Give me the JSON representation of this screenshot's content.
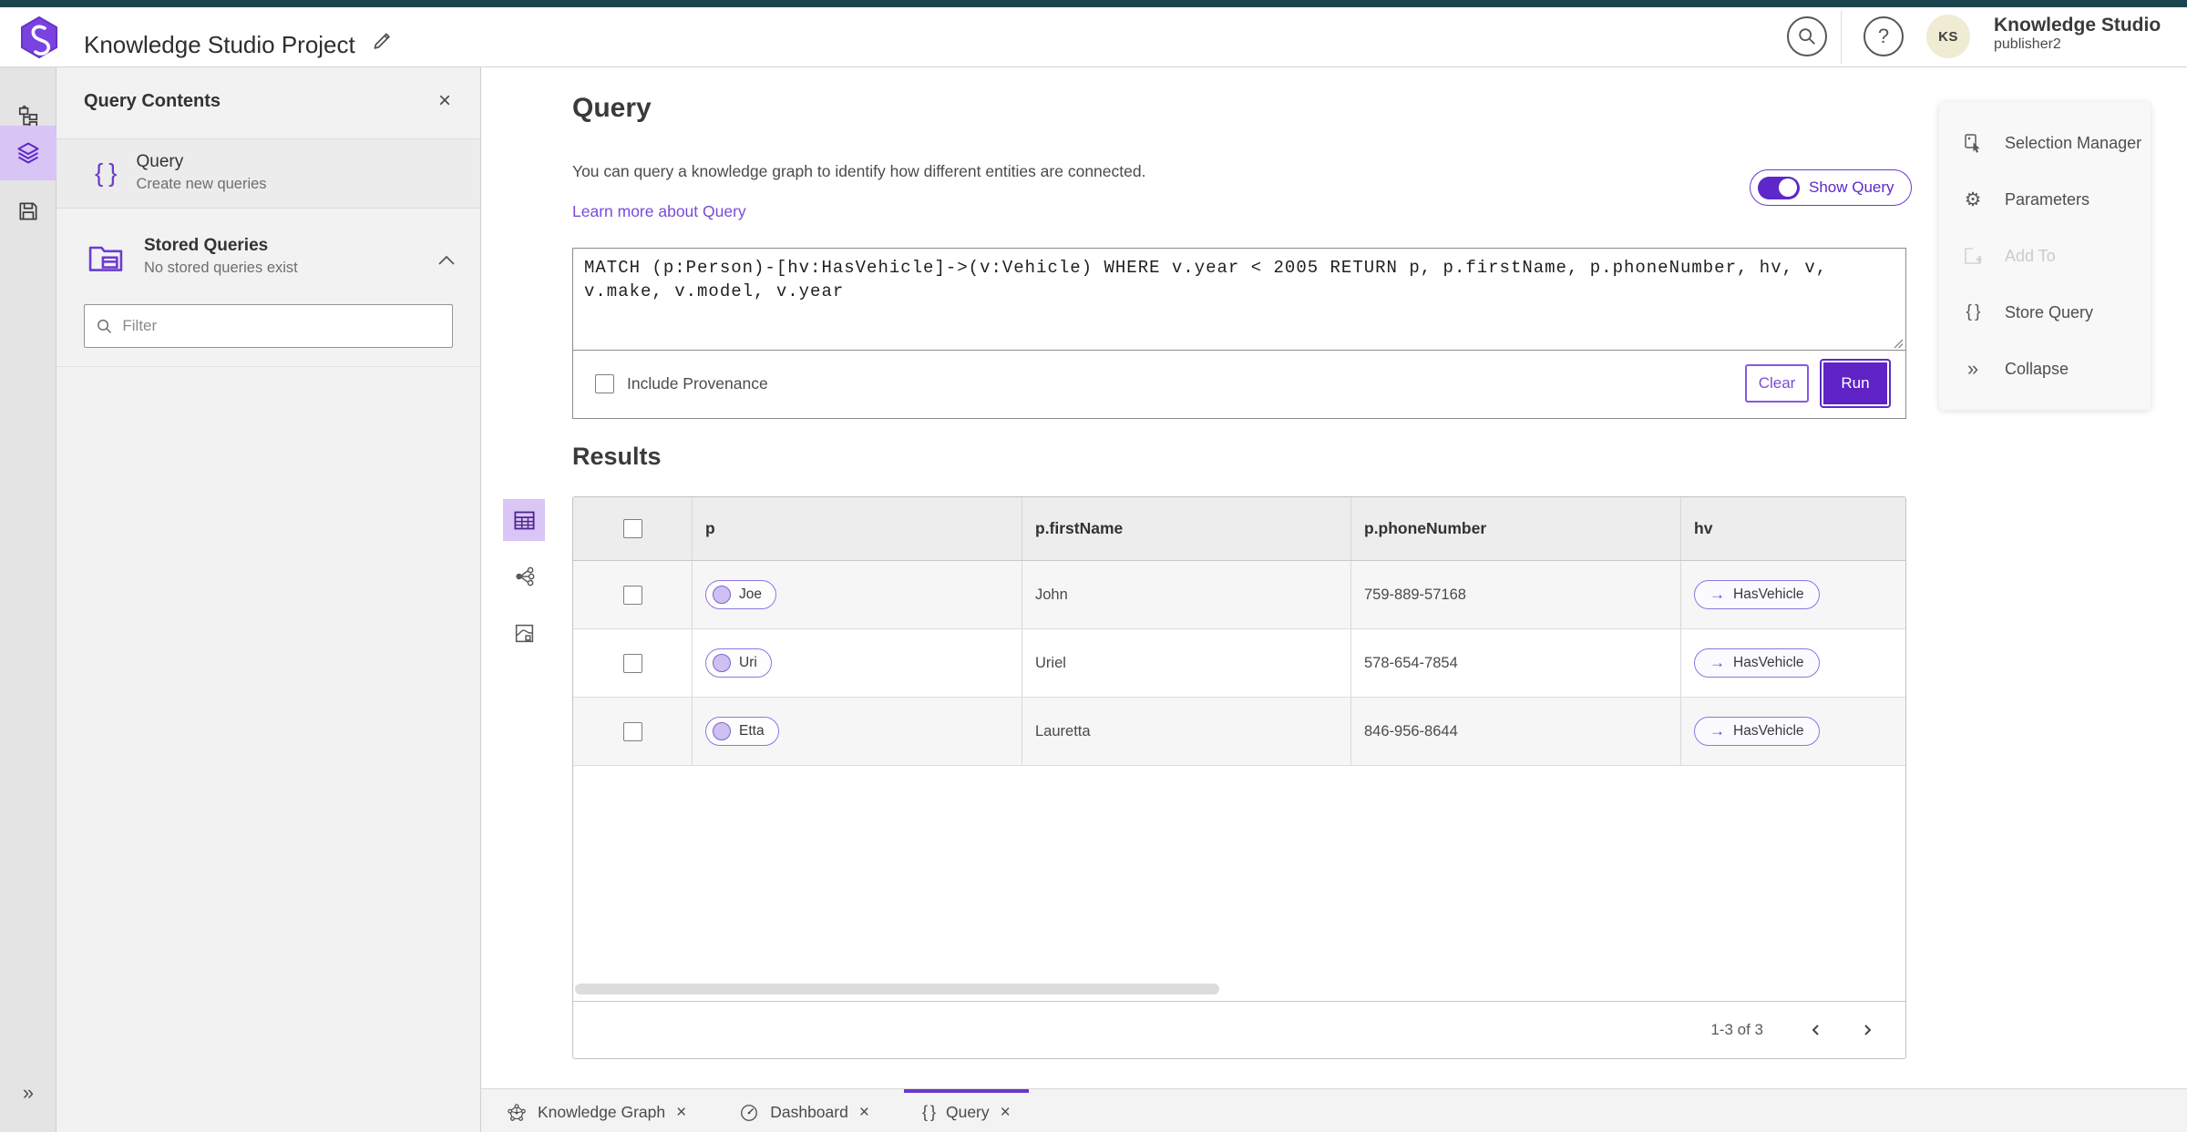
{
  "app": {
    "title": "Knowledge Studio Project",
    "account": {
      "name": "Knowledge Studio",
      "role": "publisher2",
      "initials": "KS"
    }
  },
  "query_contents": {
    "title": "Query Contents",
    "query_item": {
      "title": "Query",
      "subtitle": "Create new queries"
    },
    "stored_item": {
      "title": "Stored Queries",
      "subtitle": "No stored queries exist"
    },
    "filter_placeholder": "Filter"
  },
  "query": {
    "heading": "Query",
    "description": "You can query a knowledge graph to identify how different entities are connected.",
    "learn_more": "Learn more about Query",
    "show_query": "Show Query",
    "text": "MATCH (p:Person)-[hv:HasVehicle]->(v:Vehicle) WHERE v.year < 2005 RETURN p, p.firstName, p.phoneNumber, hv, v, v.make, v.model, v.year",
    "include_provenance": "Include Provenance",
    "clear": "Clear",
    "run": "Run"
  },
  "results": {
    "heading": "Results",
    "columns": [
      "p",
      "p.firstName",
      "p.phoneNumber",
      "hv"
    ],
    "rows": [
      {
        "p": "Joe",
        "firstName": "John",
        "phone": "759-889-57168",
        "hv": "HasVehicle"
      },
      {
        "p": "Uri",
        "firstName": "Uriel",
        "phone": "578-654-7854",
        "hv": "HasVehicle"
      },
      {
        "p": "Etta",
        "firstName": "Lauretta",
        "phone": "846-956-8644",
        "hv": "HasVehicle"
      }
    ],
    "pagination": "1-3 of 3"
  },
  "actions_panel": {
    "items": [
      {
        "label": "Selection Manager"
      },
      {
        "label": "Parameters"
      },
      {
        "label": "Add To"
      },
      {
        "label": "Store Query"
      },
      {
        "label": "Collapse"
      }
    ]
  },
  "tabs": [
    {
      "label": "Knowledge Graph"
    },
    {
      "label": "Dashboard"
    },
    {
      "label": "Query"
    }
  ],
  "icons": {
    "braces": "{ }",
    "collapse": "»",
    "arrow_right": "→",
    "close": "×",
    "help": "?",
    "gear": "⚙"
  },
  "colors": {
    "accent": "#5e27c9",
    "top_strip": "#1b454d",
    "avatar_bg": "#efecd3",
    "rail_active_bg": "#d8c4f5"
  }
}
